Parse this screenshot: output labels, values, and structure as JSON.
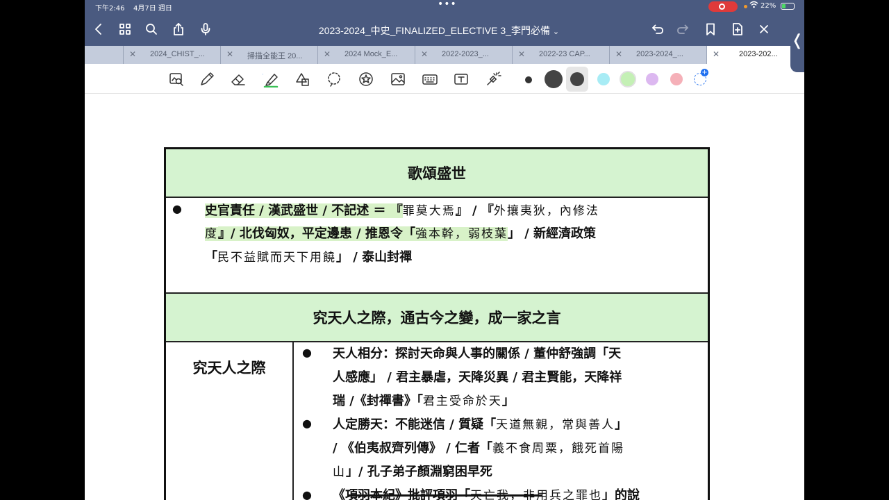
{
  "status": {
    "time": "下午2:46",
    "date": "4月7日 週日",
    "battery": "22%",
    "dots": "•••"
  },
  "nav": {
    "title": "2023-2024_中史_FINALIZED_ELECTIVE 3_李門必備",
    "title_chevron": "⌄"
  },
  "tabs": [
    {
      "label": "2024_CHIST_..."
    },
    {
      "label": "掃描全能王 20..."
    },
    {
      "label": "2024 Mock_E..."
    },
    {
      "label": "2022-2023_..."
    },
    {
      "label": "2022-23 CAP..."
    },
    {
      "label": "2023-2024_..."
    },
    {
      "label": "2023-202..."
    }
  ],
  "colors": {
    "nav_bg": "#4a5a80",
    "tab_bg": "#c4ccdc",
    "header_green": "#d5f3d0",
    "highlight_green": "#d8f2c8",
    "swatches": [
      "#333333",
      "#444444",
      "#444444",
      "#a8ecf5",
      "#c4f0b5",
      "#dcb8f0",
      "#f5b0b8"
    ]
  },
  "toolbar": {
    "tools": [
      "lasso-zoom-icon",
      "pen-icon",
      "eraser-icon",
      "highlighter-icon",
      "shapes-icon",
      "lasso-icon",
      "sticker-icon",
      "image-icon",
      "keyboard-icon",
      "text-icon",
      "laser-pointer-icon"
    ]
  },
  "handle": "❬",
  "doc": {
    "header1": "歌頌盛世",
    "header2": "究天人之際，通古今之變，成一家之言",
    "left_label": "究天人之際",
    "bullet": "●",
    "s1": {
      "l1a": "史官責任 / 漢武盛世 / 不記述 ＝ 『",
      "l1b": "罪莫大焉",
      "l1c": "』 / 『",
      "l1d": "外攘夷狄，內修法",
      "l2a": "度",
      "l2b": "』/ 北伐匈奴，平定邊患 / 推恩令「",
      "l2c": "強本幹，弱枝葉",
      "l2d": "」 / 新經濟政策",
      "l3a": "「",
      "l3b": "民不益賦而天下用饒",
      "l3c": "」 / 泰山封禪"
    },
    "s2": {
      "a1": "天人相分：探討天命與人事的關係 / 董仲舒強調「天",
      "a2": "人感應」 / 君主暴虐，天降災異 / 君主賢能，天降祥",
      "a3a": "瑞 /《封禪書》「",
      "a3b": "君主受命於天",
      "a3c": "」",
      "b1a": "人定勝天：不能迷信 / 質疑「",
      "b1b": "天道無親，常與善人",
      "b1c": "」",
      "b2a": "/ 《伯夷叔齊列傳》 / 仁者「",
      "b2b": "義不食周粟，餓死首陽",
      "b3a": "山",
      "b3b": "」/ 孔子弟子顏淵窮困早死",
      "c1a": "《項羽本紀》批評項羽「",
      "c1b": "天亡我，非用兵之罪也",
      "c1c": "」的說"
    }
  }
}
